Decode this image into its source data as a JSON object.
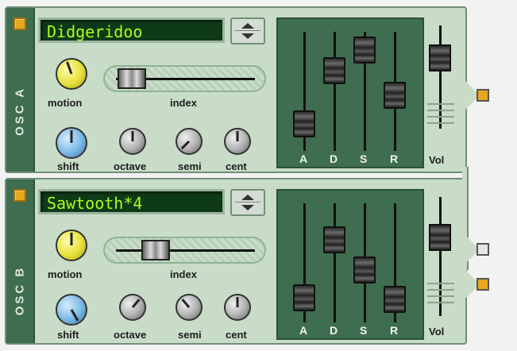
{
  "oscillators": [
    {
      "id": "A",
      "strip_label": "OSC A",
      "waveform": "Didgeridoo",
      "knobs": {
        "motion": "motion",
        "shift": "shift",
        "octave": "octave",
        "semi": "semi",
        "cent": "cent"
      },
      "index_label": "index",
      "index_value": 0.08,
      "env_labels": [
        "A",
        "D",
        "S",
        "R"
      ],
      "env_values": {
        "A": 0.15,
        "D": 0.72,
        "S": 0.95,
        "R": 0.46
      },
      "vol_label": "Vol",
      "vol_value": 0.78,
      "power_color": "#e8a520",
      "output_color": "#e8a520"
    },
    {
      "id": "B",
      "strip_label": "OSC B",
      "waveform": "Sawtooth*4",
      "knobs": {
        "motion": "motion",
        "shift": "shift",
        "octave": "octave",
        "semi": "semi",
        "cent": "cent"
      },
      "index_label": "index",
      "index_value": 0.27,
      "env_labels": [
        "A",
        "D",
        "S",
        "R"
      ],
      "env_values": {
        "A": 0.12,
        "D": 0.75,
        "S": 0.42,
        "R": 0.1
      },
      "vol_label": "Vol",
      "vol_value": 0.7,
      "power_color": "#e8a520",
      "output_color": "#e8a520"
    }
  ],
  "mid_output_color": "#e6e6e6"
}
